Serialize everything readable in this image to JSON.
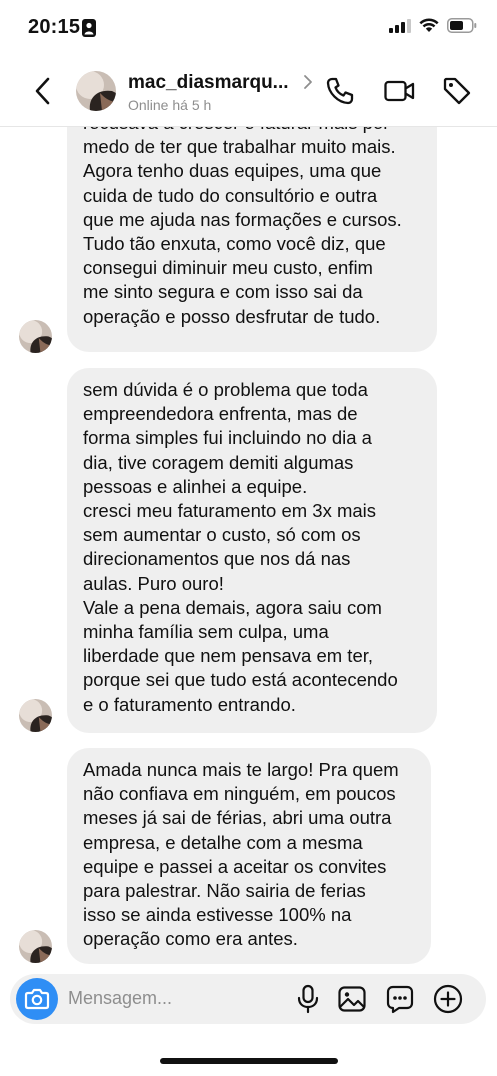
{
  "status_bar": {
    "time": "20:15"
  },
  "header": {
    "username": "mac_diasmarqu...",
    "presence": "Online há 5 h"
  },
  "messages": [
    {
      "lines": [
        "recusava a crescer e faturar mais por",
        "medo de ter que trabalhar muito mais.",
        "Agora tenho duas equipes, uma que",
        "cuida de tudo do consultório e outra",
        "que me ajuda nas formações e cursos.",
        "Tudo tão enxuta, como você diz, que",
        "consegui diminuir meu custo, enfim",
        "me sinto segura e com isso sai da",
        "operação e posso desfrutar de tudo."
      ]
    },
    {
      "lines": [
        "sem dúvida é o problema que toda",
        "empreendedora enfrenta, mas de",
        "forma simples fui incluindo no dia a",
        "dia, tive coragem demiti algumas",
        "pessoas e alinhei a equipe.",
        "cresci meu faturamento em 3x mais",
        "sem aumentar o custo, só com os",
        "direcionamentos que nos dá nas",
        "aulas. Puro ouro!",
        "Vale a pena demais, agora saiu com",
        "minha família sem culpa, uma",
        "liberdade que nem pensava em ter,",
        "porque sei que tudo está acontecendo",
        "e o faturamento entrando."
      ]
    },
    {
      "lines": [
        "Amada nunca mais te largo! Pra quem",
        "não confiava em ninguém, em poucos",
        "meses já sai de férias, abri uma outra",
        "empresa, e detalhe com a mesma",
        "equipe e passei a aceitar os convites",
        "para palestrar. Não sairia de ferias",
        "isso se ainda estivesse 100% na",
        "operação como era antes."
      ]
    }
  ],
  "composer": {
    "placeholder": "Mensagem..."
  },
  "colors": {
    "accent": "#2f8ef5",
    "bubble": "#efefef",
    "muted": "#8e8e8e"
  },
  "icons": {
    "back": "chevron-left-icon",
    "call": "phone-icon",
    "video": "video-camera-icon",
    "tag": "tag-icon",
    "camera": "camera-icon",
    "mic": "microphone-icon",
    "gallery": "image-icon",
    "sticker": "chat-bubble-icon",
    "plus": "plus-circle-icon"
  }
}
